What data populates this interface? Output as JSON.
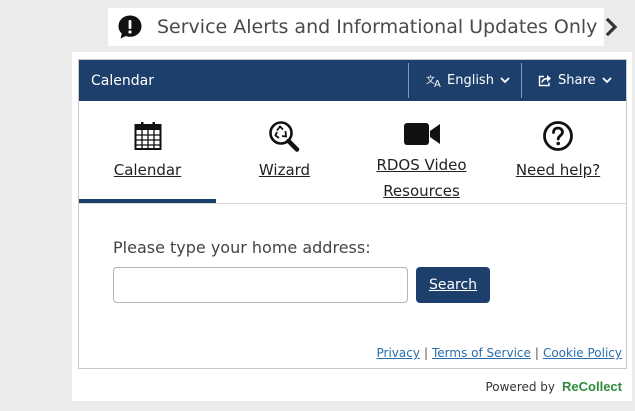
{
  "alert": {
    "text": "Service Alerts and Informational Updates Only",
    "icon": "chat-alert-icon"
  },
  "header": {
    "title": "Calendar",
    "language_label": "English",
    "share_label": "Share",
    "background_color": "#1d3f6c"
  },
  "tabs": [
    {
      "label": "Calendar",
      "icon": "calendar-icon",
      "active": true
    },
    {
      "label": "Wizard",
      "icon": "recycle-search-icon",
      "active": false
    },
    {
      "label": "RDOS Video Resources",
      "label_line1": "RDOS Video",
      "label_line2": "Resources",
      "icon": "video-camera-icon",
      "active": false
    },
    {
      "label": "Need help?",
      "icon": "help-circle-icon",
      "active": false
    }
  ],
  "search": {
    "prompt": "Please type your home address:",
    "value": "",
    "button_label": "Search"
  },
  "footer": {
    "privacy": "Privacy",
    "terms": "Terms of Service",
    "cookie": "Cookie Policy",
    "powered_by": "Powered by",
    "brand": "ReCollect"
  }
}
